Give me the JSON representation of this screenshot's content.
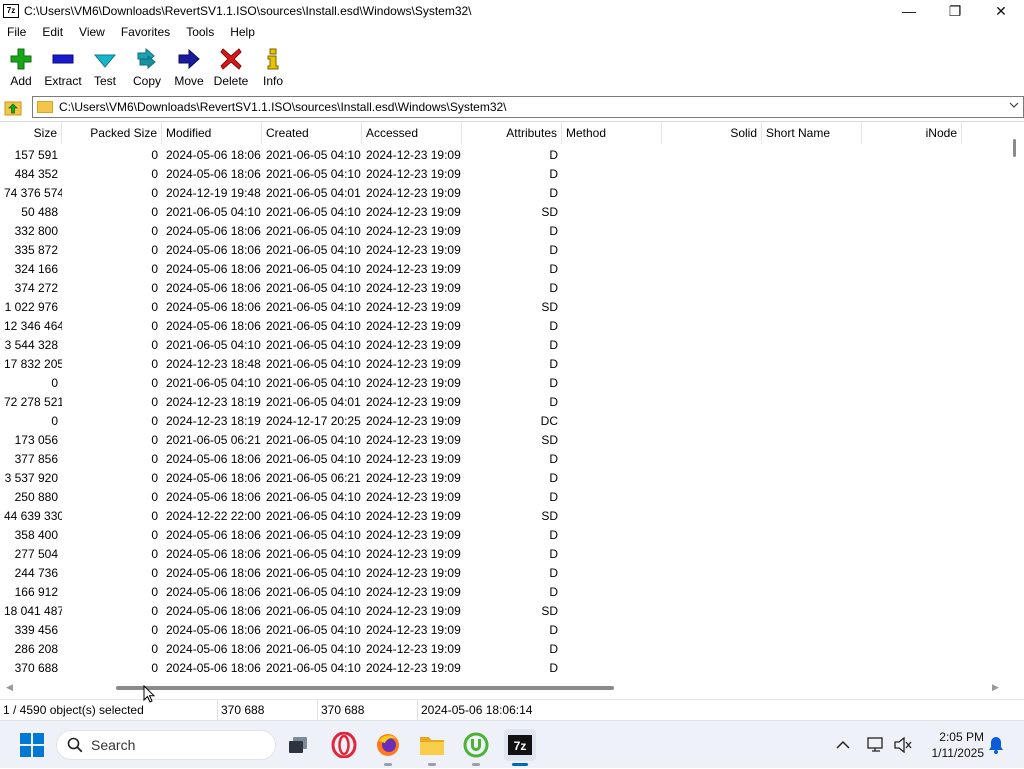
{
  "window": {
    "app_icon_text": "7z",
    "title": "C:\\Users\\VM6\\Downloads\\RevertSV1.1.ISO\\sources\\Install.esd\\Windows\\System32\\",
    "controls": {
      "minimize": "—",
      "maximize": "❐",
      "close": "✕"
    }
  },
  "menu": [
    "File",
    "Edit",
    "View",
    "Favorites",
    "Tools",
    "Help"
  ],
  "toolbar": [
    {
      "label": "Add",
      "icon": "plus-icon",
      "color": "#1aa61a"
    },
    {
      "label": "Extract",
      "icon": "minus-icon",
      "color": "#1a1acd"
    },
    {
      "label": "Test",
      "icon": "check-icon",
      "color": "#19b4c9"
    },
    {
      "label": "Copy",
      "icon": "double-arrow-icon",
      "color": "#19a3b4"
    },
    {
      "label": "Move",
      "icon": "arrow-right-icon",
      "color": "#1a1a9e"
    },
    {
      "label": "Delete",
      "icon": "x-icon",
      "color": "#d11a1a"
    },
    {
      "label": "Info",
      "icon": "info-icon",
      "color": "#c9a100"
    }
  ],
  "address": {
    "path": "C:\\Users\\VM6\\Downloads\\RevertSV1.1.ISO\\sources\\Install.esd\\Windows\\System32\\"
  },
  "columns": {
    "size": "Size",
    "packed": "Packed Size",
    "modified": "Modified",
    "created": "Created",
    "accessed": "Accessed",
    "attributes": "Attributes",
    "method": "Method",
    "solid": "Solid",
    "short_name": "Short Name",
    "inode": "iNode"
  },
  "rows": [
    [
      "157 591",
      "0",
      "2024-05-06 18:06",
      "2021-06-05 04:10",
      "2024-12-23 19:09",
      "D"
    ],
    [
      "484 352",
      "0",
      "2024-05-06 18:06",
      "2021-06-05 04:10",
      "2024-12-23 19:09",
      "D"
    ],
    [
      "74 376 574",
      "0",
      "2024-12-19 19:48",
      "2021-06-05 04:01",
      "2024-12-23 19:09",
      "D"
    ],
    [
      "50 488",
      "0",
      "2021-06-05 04:10",
      "2021-06-05 04:10",
      "2024-12-23 19:09",
      "SD"
    ],
    [
      "332 800",
      "0",
      "2024-05-06 18:06",
      "2021-06-05 04:10",
      "2024-12-23 19:09",
      "D"
    ],
    [
      "335 872",
      "0",
      "2024-05-06 18:06",
      "2021-06-05 04:10",
      "2024-12-23 19:09",
      "D"
    ],
    [
      "324 166",
      "0",
      "2024-05-06 18:06",
      "2021-06-05 04:10",
      "2024-12-23 19:09",
      "D"
    ],
    [
      "374 272",
      "0",
      "2024-05-06 18:06",
      "2021-06-05 04:10",
      "2024-12-23 19:09",
      "D"
    ],
    [
      "1 022 976",
      "0",
      "2024-05-06 18:06",
      "2021-06-05 04:10",
      "2024-12-23 19:09",
      "SD"
    ],
    [
      "12 346 464",
      "0",
      "2024-05-06 18:06",
      "2021-06-05 04:10",
      "2024-12-23 19:09",
      "D"
    ],
    [
      "3 544 328",
      "0",
      "2021-06-05 04:10",
      "2021-06-05 04:10",
      "2024-12-23 19:09",
      "D"
    ],
    [
      "17 832 205",
      "0",
      "2024-12-23 18:48",
      "2021-06-05 04:10",
      "2024-12-23 19:09",
      "D"
    ],
    [
      "0",
      "0",
      "2021-06-05 04:10",
      "2021-06-05 04:10",
      "2024-12-23 19:09",
      "D"
    ],
    [
      "72 278 521",
      "0",
      "2024-12-23 18:19",
      "2021-06-05 04:01",
      "2024-12-23 19:09",
      "D"
    ],
    [
      "0",
      "0",
      "2024-12-23 18:19",
      "2024-12-17 20:25",
      "2024-12-23 19:09",
      "DC"
    ],
    [
      "173 056",
      "0",
      "2021-06-05 06:21",
      "2021-06-05 04:10",
      "2024-12-23 19:09",
      "SD"
    ],
    [
      "377 856",
      "0",
      "2024-05-06 18:06",
      "2021-06-05 04:10",
      "2024-12-23 19:09",
      "D"
    ],
    [
      "3 537 920",
      "0",
      "2024-05-06 18:06",
      "2021-06-05 06:21",
      "2024-12-23 19:09",
      "D"
    ],
    [
      "250 880",
      "0",
      "2024-05-06 18:06",
      "2021-06-05 04:10",
      "2024-12-23 19:09",
      "D"
    ],
    [
      "44 639 330",
      "0",
      "2024-12-22 22:00",
      "2021-06-05 04:10",
      "2024-12-23 19:09",
      "SD"
    ],
    [
      "358 400",
      "0",
      "2024-05-06 18:06",
      "2021-06-05 04:10",
      "2024-12-23 19:09",
      "D"
    ],
    [
      "277 504",
      "0",
      "2024-05-06 18:06",
      "2021-06-05 04:10",
      "2024-12-23 19:09",
      "D"
    ],
    [
      "244 736",
      "0",
      "2024-05-06 18:06",
      "2021-06-05 04:10",
      "2024-12-23 19:09",
      "D"
    ],
    [
      "166 912",
      "0",
      "2024-05-06 18:06",
      "2021-06-05 04:10",
      "2024-12-23 19:09",
      "D"
    ],
    [
      "18 041 487",
      "0",
      "2024-05-06 18:06",
      "2021-06-05 04:10",
      "2024-12-23 19:09",
      "SD"
    ],
    [
      "339 456",
      "0",
      "2024-05-06 18:06",
      "2021-06-05 04:10",
      "2024-12-23 19:09",
      "D"
    ],
    [
      "286 208",
      "0",
      "2024-05-06 18:06",
      "2021-06-05 04:10",
      "2024-12-23 19:09",
      "D"
    ],
    [
      "370 688",
      "0",
      "2024-05-06 18:06",
      "2021-06-05 04:10",
      "2024-12-23 19:09",
      "D"
    ]
  ],
  "status": {
    "selected": "1 / 4590 object(s) selected",
    "size": "370 688",
    "packed": "370 688",
    "modified": "2024-05-06 18:06:14"
  },
  "taskbar": {
    "search_placeholder": "Search",
    "apps": [
      "task-view-icon",
      "opera-icon",
      "firefox-icon",
      "file-explorer-icon",
      "utorrent-icon",
      "7zip-icon"
    ],
    "clock_time": "2:05 PM",
    "clock_date": "1/11/2025"
  }
}
